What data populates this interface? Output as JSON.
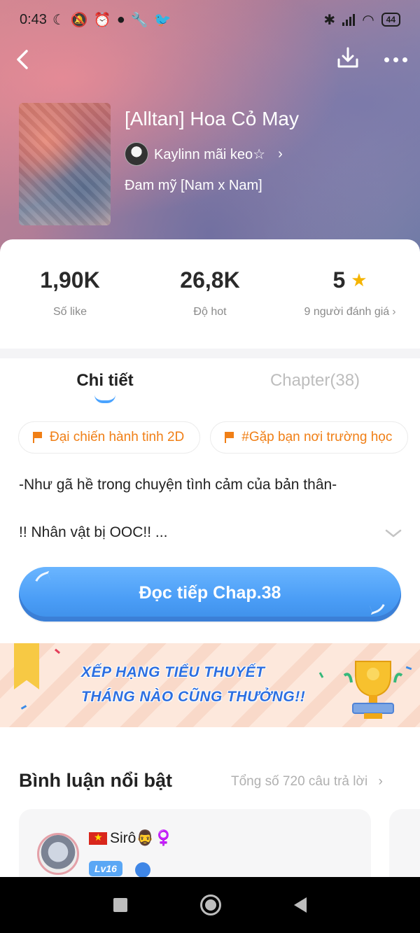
{
  "status_bar": {
    "time": "0:43",
    "battery": "44"
  },
  "book": {
    "title": "[Alltan] Hoa Cỏ May",
    "author": "Kaylinn mãi keo☆",
    "genre": "Đam mỹ [Nam x Nam]"
  },
  "stats": {
    "likes_value": "1,90K",
    "likes_label": "Số like",
    "hot_value": "26,8K",
    "hot_label": "Độ hot",
    "rating_value": "5",
    "rating_label": "9 người đánh giá"
  },
  "tabs": {
    "detail": "Chi tiết",
    "chapters": "Chapter(38)"
  },
  "tags": [
    "Đại chiến hành tinh 2D",
    "#Gặp bạn nơi trường học"
  ],
  "description": {
    "line1": "-Như gã hề trong chuyện tình cảm của bản thân-",
    "line2": "!! Nhân vật bị OOC!! ..."
  },
  "read_button": "Đọc tiếp Chap.38",
  "banner": {
    "line1": "XẾP HẠNG TIỂU THUYẾT",
    "line2": "THÁNG NÀO CŨNG THƯỞNG!!"
  },
  "comments": {
    "title": "Bình luận nổi bật",
    "total": "Tổng số 720 câu trả lời",
    "first": {
      "name": "Sirô🧔‍♂️♀️",
      "level": "Lv16"
    }
  },
  "colors": {
    "accent": "#4a9df6",
    "tag_orange": "#f07f16",
    "star": "#f5b400"
  }
}
